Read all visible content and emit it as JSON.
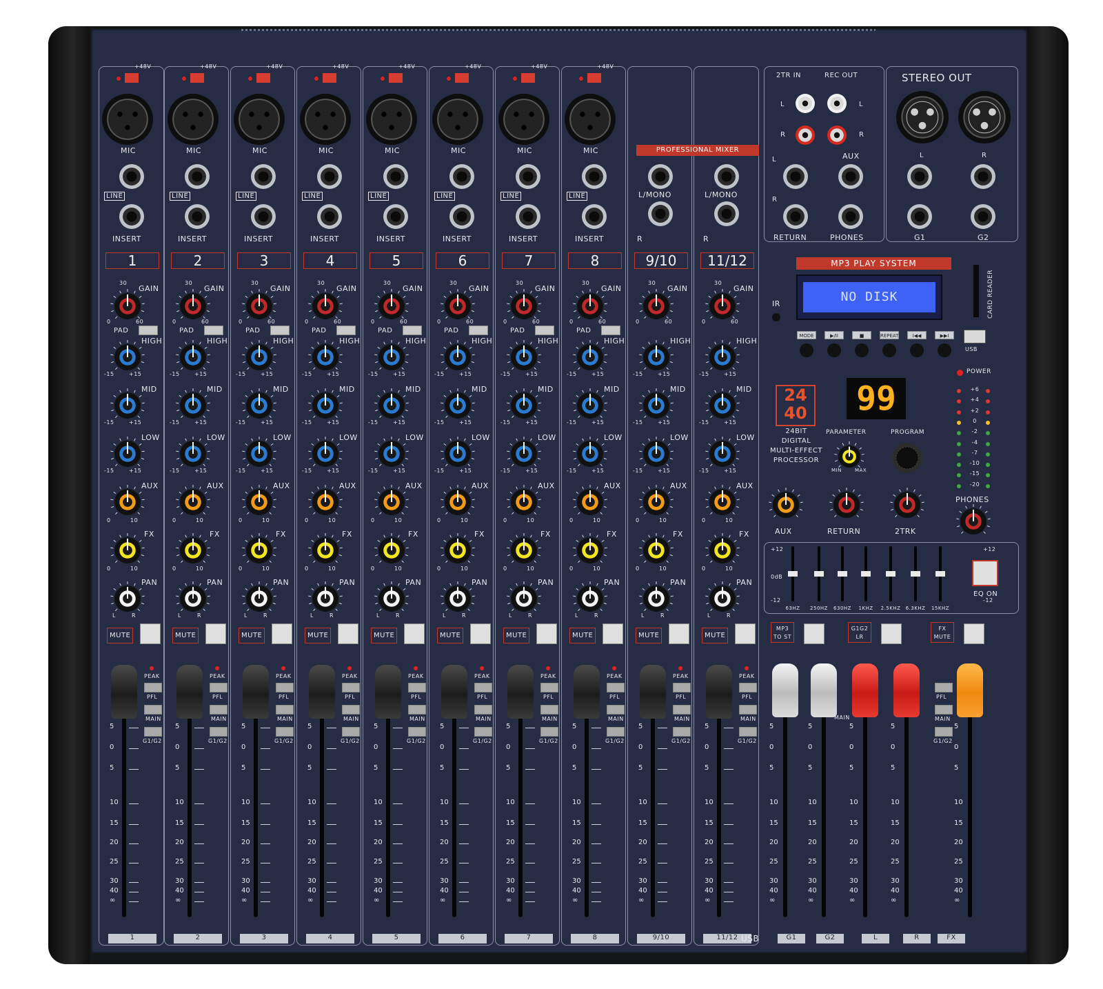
{
  "channels": {
    "labels": [
      "1",
      "2",
      "3",
      "4",
      "5",
      "6",
      "7",
      "8",
      "9/10",
      "11/12"
    ],
    "bottom_labels": [
      "1",
      "2",
      "3",
      "4",
      "5",
      "6",
      "7",
      "8",
      "9/10",
      "11/12"
    ],
    "mic": "MIC",
    "line": "LINE",
    "insert": "INSERT",
    "phantom": "+48V",
    "l_mono": "L/MONO",
    "r": "R",
    "gain": "GAIN",
    "gain_min": "0",
    "gain_mid": "30",
    "gain_max": "60",
    "pad": "PAD",
    "high": "HIGH",
    "mid": "MID",
    "low": "LOW",
    "eq_min": "-15",
    "eq_max": "+15",
    "aux": "AUX",
    "fx": "FX",
    "send_min": "0",
    "send_max": "10",
    "pan": "PAN",
    "pan_l": "L",
    "pan_r": "R",
    "mute": "MUTE",
    "peak": "PEAK",
    "pfl": "PFL",
    "main": "MAIN",
    "g1g2": "G1/G2"
  },
  "fader_scale": [
    "5",
    "0",
    "5",
    "10",
    "15",
    "20",
    "25",
    "30",
    "40",
    "∞"
  ],
  "io": {
    "twotr_in": "2TR IN",
    "rec_out": "REC OUT",
    "stereo_out": "STEREO OUT",
    "l": "L",
    "r": "R",
    "aux": "AUX",
    "return": "RETURN",
    "phones": "PHONES",
    "g1": "G1",
    "g2": "G2"
  },
  "professional_mixer": "PROFESSIONAL MIXER",
  "mp3": {
    "header": "MP3 PLAY SYSTEM",
    "display": "NO DISK",
    "ir": "IR",
    "card_reader": "CARD READER",
    "usb": "USB",
    "buttons": [
      "MODE",
      "▶/II",
      "■",
      "REPEAT",
      "I◀◀",
      "▶▶I"
    ]
  },
  "effects": {
    "badge_top": "24",
    "badge_bottom": "40",
    "display": "99",
    "description": [
      "24BIT",
      "DIGITAL",
      "MULTI-EFFECT",
      "PROCESSOR"
    ],
    "parameter": "PARAMETER",
    "program": "PROGRAM",
    "min": "MIN",
    "max": "MAX"
  },
  "master": {
    "power": "POWER",
    "phones": "PHONES",
    "aux": "AUX",
    "return": "RETURN",
    "twotrk": "2TRK",
    "meter_labels": [
      "+6",
      "+4",
      "+2",
      "0",
      "-2",
      "-4",
      "-7",
      "-10",
      "-15",
      "-20"
    ],
    "eq_bands": [
      "63HZ",
      "250HZ",
      "630HZ",
      "1KHZ",
      "2.5KHZ",
      "6.3KHZ",
      "15KHZ"
    ],
    "eq_plus": "+12",
    "eq_zero": "0dB",
    "eq_minus": "-12",
    "eq_on": "EQ ON",
    "mp3_to_st": [
      "MP3",
      "TO ST"
    ],
    "g1g2_lr": [
      "G1G2",
      "LR"
    ],
    "fx_mute": [
      "FX",
      "MUTE"
    ],
    "main_label": "MAIN",
    "bottom_labels": [
      "USB",
      "G1",
      "G2",
      "L",
      "R",
      "FX"
    ]
  },
  "colors": {
    "panel": "#252c44",
    "gain_knob": "#c0282a",
    "eq_knob": "#2a7bd1",
    "aux_knob": "#f29a1a",
    "fx_knob": "#f3e424",
    "pan_knob": "#f4f4f4",
    "accent_red": "#c0392b",
    "lcd": "#3d62f5"
  }
}
